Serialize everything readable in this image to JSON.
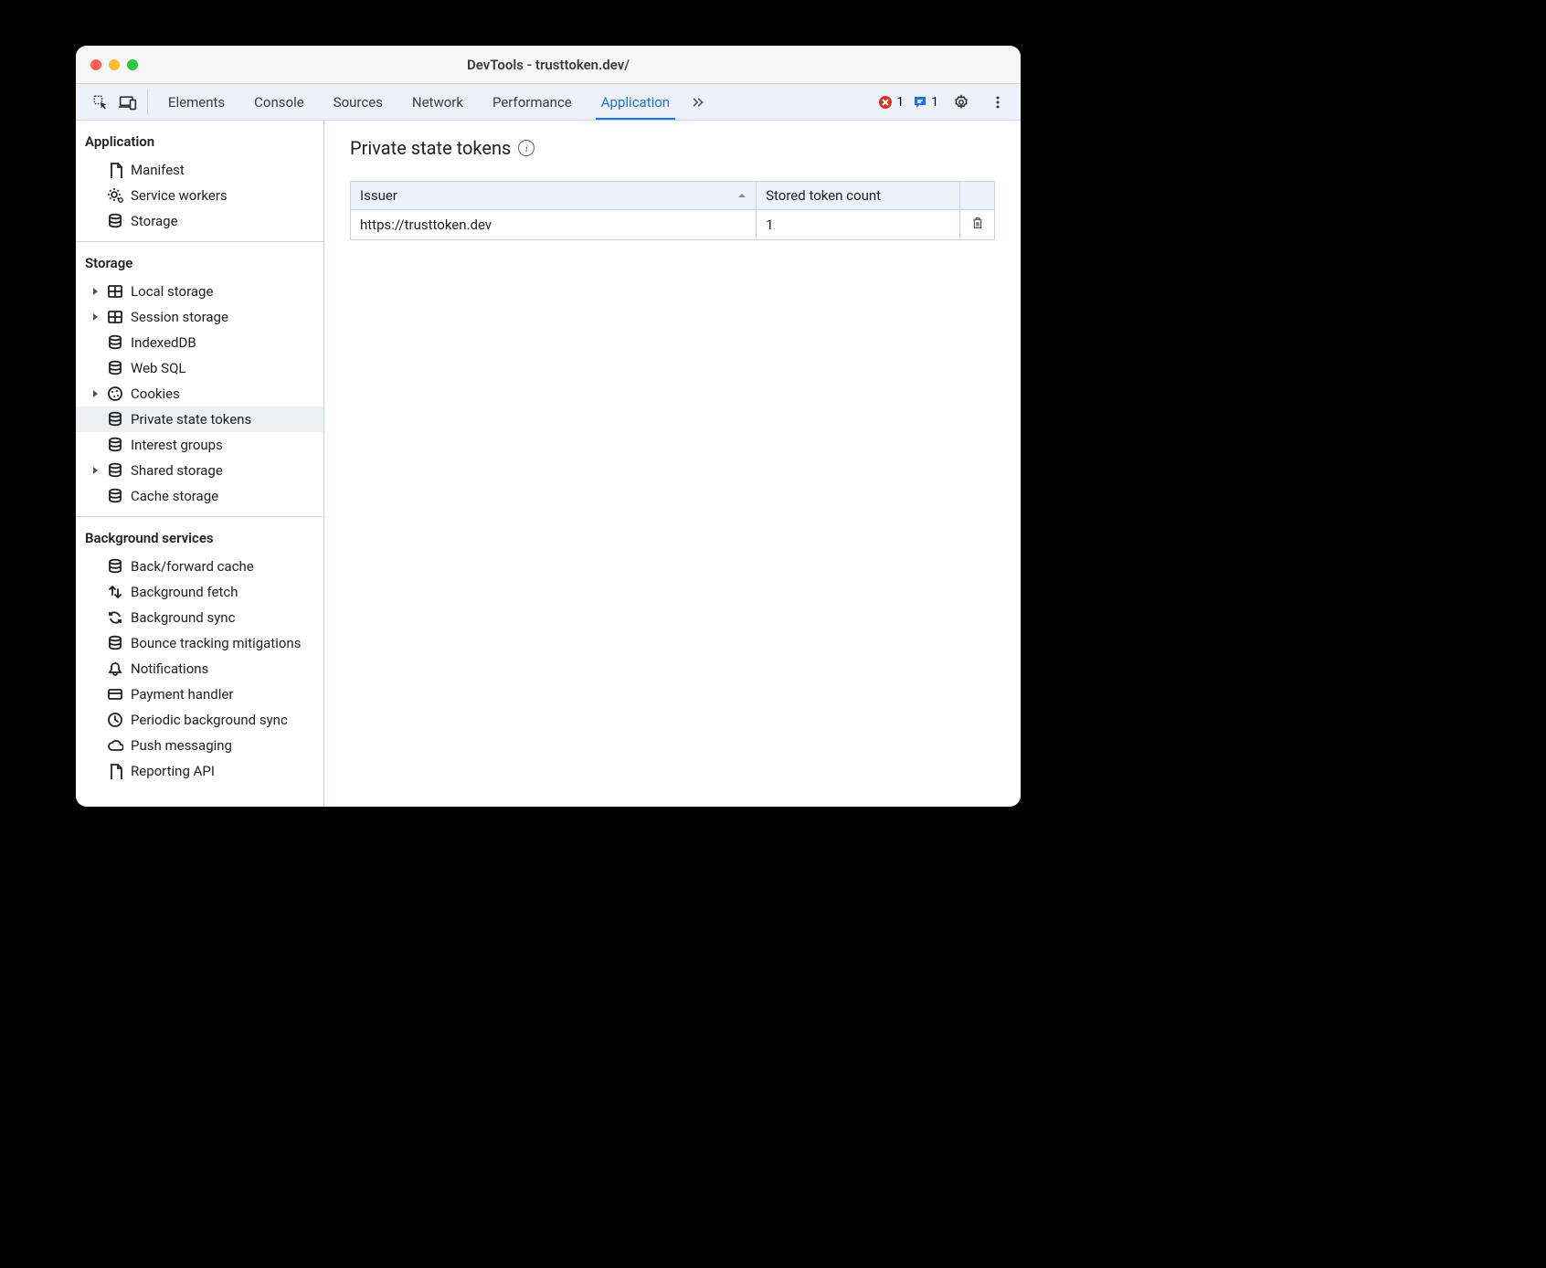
{
  "window": {
    "title": "DevTools - trusttoken.dev/"
  },
  "toolbar": {
    "tabs": [
      "Elements",
      "Console",
      "Sources",
      "Network",
      "Performance",
      "Application"
    ],
    "active_tab": "Application",
    "error_count": "1",
    "message_count": "1"
  },
  "sidebar": {
    "sections": [
      {
        "title": "Application",
        "items": [
          {
            "label": "Manifest",
            "icon": "file-icon",
            "expandable": false,
            "selected": false
          },
          {
            "label": "Service workers",
            "icon": "gears-icon",
            "expandable": false,
            "selected": false
          },
          {
            "label": "Storage",
            "icon": "database-icon",
            "expandable": false,
            "selected": false
          }
        ]
      },
      {
        "title": "Storage",
        "items": [
          {
            "label": "Local storage",
            "icon": "table-icon",
            "expandable": true,
            "selected": false
          },
          {
            "label": "Session storage",
            "icon": "table-icon",
            "expandable": true,
            "selected": false
          },
          {
            "label": "IndexedDB",
            "icon": "database-icon",
            "expandable": false,
            "selected": false
          },
          {
            "label": "Web SQL",
            "icon": "database-icon",
            "expandable": false,
            "selected": false
          },
          {
            "label": "Cookies",
            "icon": "cookie-icon",
            "expandable": true,
            "selected": false
          },
          {
            "label": "Private state tokens",
            "icon": "database-icon",
            "expandable": false,
            "selected": true
          },
          {
            "label": "Interest groups",
            "icon": "database-icon",
            "expandable": false,
            "selected": false
          },
          {
            "label": "Shared storage",
            "icon": "database-icon",
            "expandable": true,
            "selected": false
          },
          {
            "label": "Cache storage",
            "icon": "database-icon",
            "expandable": false,
            "selected": false
          }
        ]
      },
      {
        "title": "Background services",
        "items": [
          {
            "label": "Back/forward cache",
            "icon": "database-icon",
            "expandable": false,
            "selected": false
          },
          {
            "label": "Background fetch",
            "icon": "fetch-icon",
            "expandable": false,
            "selected": false
          },
          {
            "label": "Background sync",
            "icon": "sync-icon",
            "expandable": false,
            "selected": false
          },
          {
            "label": "Bounce tracking mitigations",
            "icon": "database-icon",
            "expandable": false,
            "selected": false
          },
          {
            "label": "Notifications",
            "icon": "bell-icon",
            "expandable": false,
            "selected": false
          },
          {
            "label": "Payment handler",
            "icon": "card-icon",
            "expandable": false,
            "selected": false
          },
          {
            "label": "Periodic background sync",
            "icon": "clock-icon",
            "expandable": false,
            "selected": false
          },
          {
            "label": "Push messaging",
            "icon": "cloud-icon",
            "expandable": false,
            "selected": false
          },
          {
            "label": "Reporting API",
            "icon": "file-icon",
            "expandable": false,
            "selected": false
          }
        ]
      }
    ]
  },
  "main": {
    "heading": "Private state tokens",
    "columns": [
      "Issuer",
      "Stored token count"
    ],
    "rows": [
      {
        "issuer": "https://trusttoken.dev",
        "count": "1"
      }
    ]
  }
}
